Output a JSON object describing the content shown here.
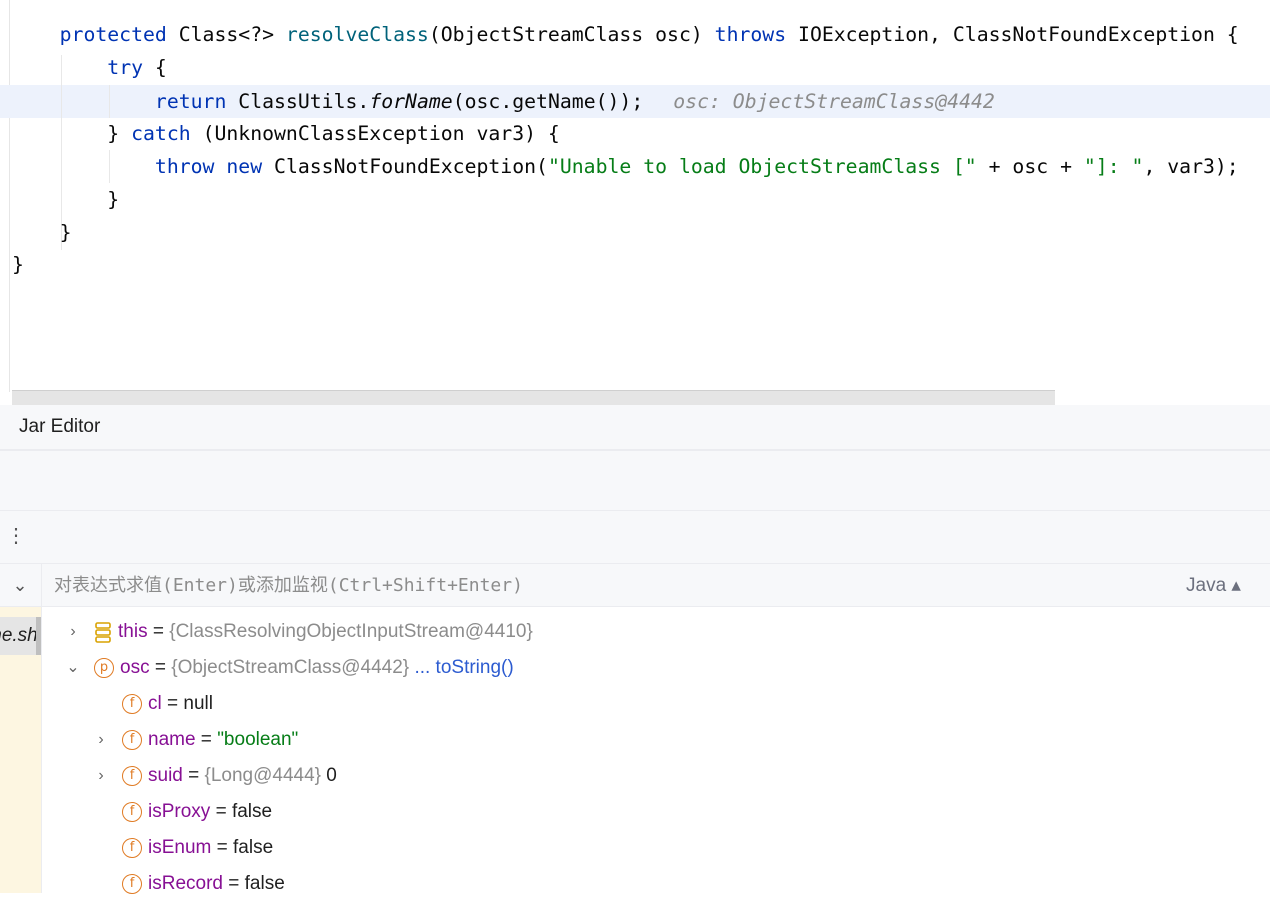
{
  "editor": {
    "line1": {
      "kw1": "protected",
      "t1": " Class<?> ",
      "fn": "resolveClass",
      "t2": "(ObjectStreamClass osc) ",
      "kw2": "throws",
      "t3": " IOException, ClassNotFoundException {"
    },
    "line2": {
      "kw": "try",
      "t": " {"
    },
    "line3": {
      "kw": "return",
      "t1": " ClassUtils.",
      "it": "forName",
      "t2": "(osc.getName());",
      "hint": "osc: ObjectStreamClass@4442"
    },
    "line4": {
      "t1": "} ",
      "kw": "catch",
      "t2": " (UnknownClassException var3) {"
    },
    "line5": {
      "kw1": "throw",
      "t1": " ",
      "kw2": "new",
      "t2": " ClassNotFoundException(",
      "s1": "\"Unable to load ObjectStreamClass [\"",
      "t3": " + osc + ",
      "s2": "\"]: \"",
      "t4": ", var3);"
    },
    "line6": "}",
    "line7": "}",
    "line8": "}"
  },
  "jar_tab": {
    "label": "Jar Editor"
  },
  "evaluate": {
    "placeholder": "对表达式求值(Enter)或添加监视(Ctrl+Shift+Enter)",
    "language": "Java ▴"
  },
  "frames": {
    "partial_label": "me.sh"
  },
  "variables": [
    {
      "name": "this",
      "eq": " = ",
      "value": "{ClassResolvingObjectInputStream@4410}",
      "icon": "stack-icon"
    },
    {
      "name": "osc",
      "eq": " = ",
      "value": "{ObjectStreamClass@4442}",
      "link": "... toString()",
      "badge": "p"
    },
    {
      "name": "cl",
      "eq": " = ",
      "value": "null",
      "badge": "f"
    },
    {
      "name": "name",
      "eq": " = ",
      "value": "\"boolean\"",
      "badge": "f"
    },
    {
      "name": "suid",
      "eq": " = ",
      "value": "{Long@4444}",
      "extra": " 0",
      "badge": "f"
    },
    {
      "name": "isProxy",
      "eq": " = ",
      "value": "false",
      "badge": "f"
    },
    {
      "name": "isEnum",
      "eq": " = ",
      "value": "false",
      "badge": "f"
    },
    {
      "name": "isRecord",
      "eq": " = ",
      "value": "false",
      "badge": "f"
    }
  ],
  "colors": {
    "keyword": "#0033b3",
    "method": "#00627a",
    "string": "#067d17",
    "field": "#871094",
    "badge": "#e07b24",
    "link": "#2c5bd0"
  }
}
